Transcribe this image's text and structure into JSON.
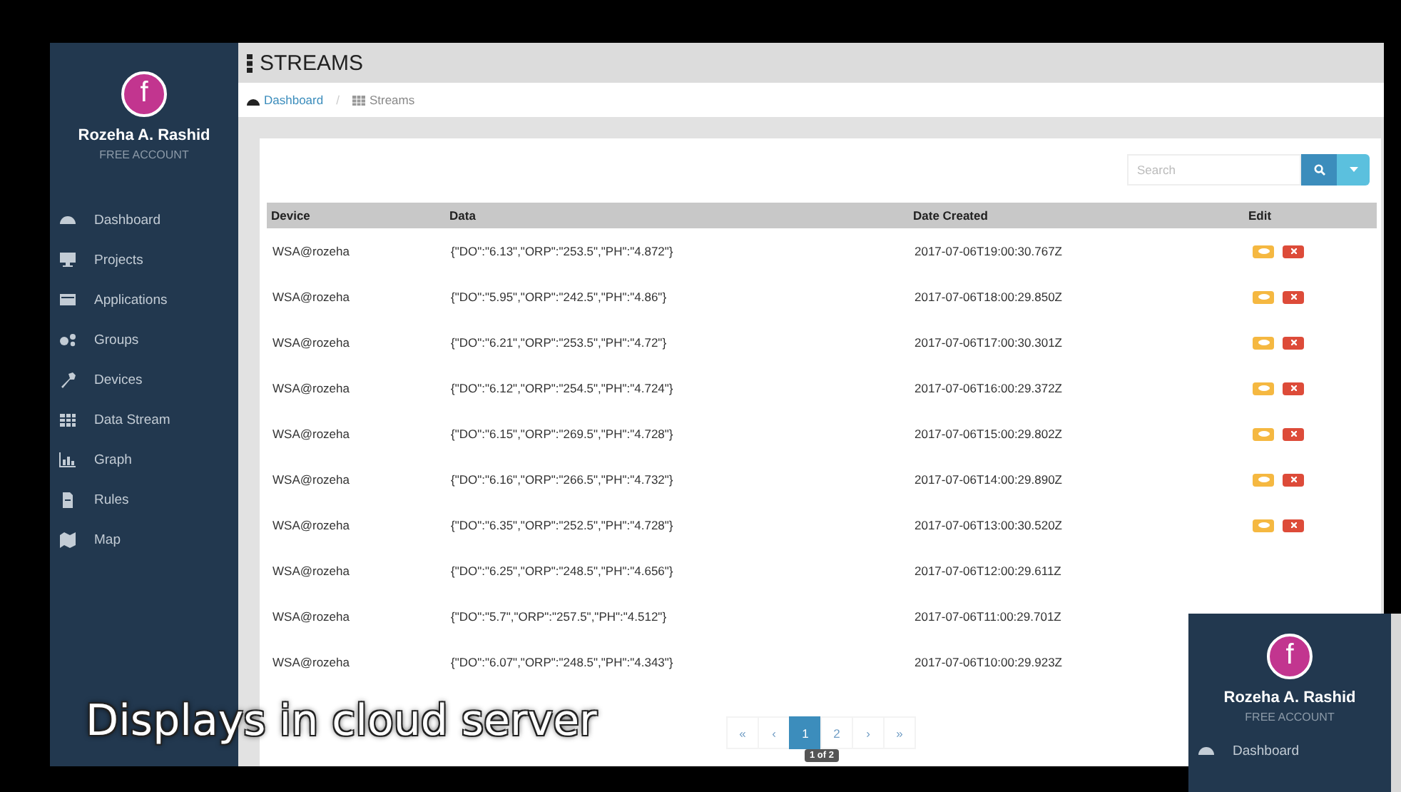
{
  "sidebar": {
    "avatar_letter": "f",
    "user_name": "Rozeha A. Rashid",
    "account_type": "FREE ACCOUNT",
    "items": [
      {
        "label": "Dashboard"
      },
      {
        "label": "Projects"
      },
      {
        "label": "Applications"
      },
      {
        "label": "Groups"
      },
      {
        "label": "Devices"
      },
      {
        "label": "Data Stream"
      },
      {
        "label": "Graph"
      },
      {
        "label": "Rules"
      },
      {
        "label": "Map"
      }
    ]
  },
  "header": {
    "title": "STREAMS"
  },
  "breadcrumb_separator": "/",
  "breadcrumb": [
    {
      "label": "Dashboard",
      "kind": "link"
    },
    {
      "label": "Streams",
      "kind": "current"
    }
  ],
  "search": {
    "placeholder": "Search"
  },
  "table": {
    "columns": [
      "Device",
      "Data",
      "Date Created",
      "Edit"
    ],
    "rows": [
      {
        "device": "WSA@rozeha",
        "data": "{\"DO\":\"6.13\",\"ORP\":\"253.5\",\"PH\":\"4.872\"}",
        "date": "2017-07-06T19:00:30.767Z",
        "actions": [
          {
            "kind": "view"
          },
          {
            "kind": "delete"
          }
        ]
      },
      {
        "device": "WSA@rozeha",
        "data": "{\"DO\":\"5.95\",\"ORP\":\"242.5\",\"PH\":\"4.86\"}",
        "date": "2017-07-06T18:00:29.850Z",
        "actions": [
          {
            "kind": "view"
          },
          {
            "kind": "delete"
          }
        ]
      },
      {
        "device": "WSA@rozeha",
        "data": "{\"DO\":\"6.21\",\"ORP\":\"253.5\",\"PH\":\"4.72\"}",
        "date": "2017-07-06T17:00:30.301Z",
        "actions": [
          {
            "kind": "view"
          },
          {
            "kind": "delete"
          }
        ]
      },
      {
        "device": "WSA@rozeha",
        "data": "{\"DO\":\"6.12\",\"ORP\":\"254.5\",\"PH\":\"4.724\"}",
        "date": "2017-07-06T16:00:29.372Z",
        "actions": [
          {
            "kind": "view"
          },
          {
            "kind": "delete"
          }
        ]
      },
      {
        "device": "WSA@rozeha",
        "data": "{\"DO\":\"6.15\",\"ORP\":\"269.5\",\"PH\":\"4.728\"}",
        "date": "2017-07-06T15:00:29.802Z",
        "actions": [
          {
            "kind": "view"
          },
          {
            "kind": "delete"
          }
        ]
      },
      {
        "device": "WSA@rozeha",
        "data": "{\"DO\":\"6.16\",\"ORP\":\"266.5\",\"PH\":\"4.732\"}",
        "date": "2017-07-06T14:00:29.890Z",
        "actions": [
          {
            "kind": "view"
          },
          {
            "kind": "delete"
          }
        ]
      },
      {
        "device": "WSA@rozeha",
        "data": "{\"DO\":\"6.35\",\"ORP\":\"252.5\",\"PH\":\"4.728\"}",
        "date": "2017-07-06T13:00:30.520Z",
        "actions": [
          {
            "kind": "view"
          },
          {
            "kind": "delete"
          }
        ]
      },
      {
        "device": "WSA@rozeha",
        "data": "{\"DO\":\"6.25\",\"ORP\":\"248.5\",\"PH\":\"4.656\"}",
        "date": "2017-07-06T12:00:29.611Z"
      },
      {
        "device": "WSA@rozeha",
        "data": "{\"DO\":\"5.7\",\"ORP\":\"257.5\",\"PH\":\"4.512\"}",
        "date": "2017-07-06T11:00:29.701Z"
      },
      {
        "device": "WSA@rozeha",
        "data": "{\"DO\":\"6.07\",\"ORP\":\"248.5\",\"PH\":\"4.343\"}",
        "date": "2017-07-06T10:00:29.923Z"
      }
    ]
  },
  "pagination": {
    "items": [
      {
        "label": "«",
        "selected": false
      },
      {
        "label": "‹",
        "selected": false
      },
      {
        "label": "1",
        "selected": true
      },
      {
        "label": "2",
        "selected": false
      },
      {
        "label": "›",
        "selected": false
      },
      {
        "label": "»",
        "selected": false
      }
    ],
    "tooltip": "1 of 2"
  },
  "inset": {
    "avatar_letter": "f",
    "user_name": "Rozeha A. Rashid",
    "account_type": "FREE ACCOUNT",
    "items": [
      {
        "label": "Dashboard"
      }
    ]
  },
  "caption": "Displays in cloud server"
}
